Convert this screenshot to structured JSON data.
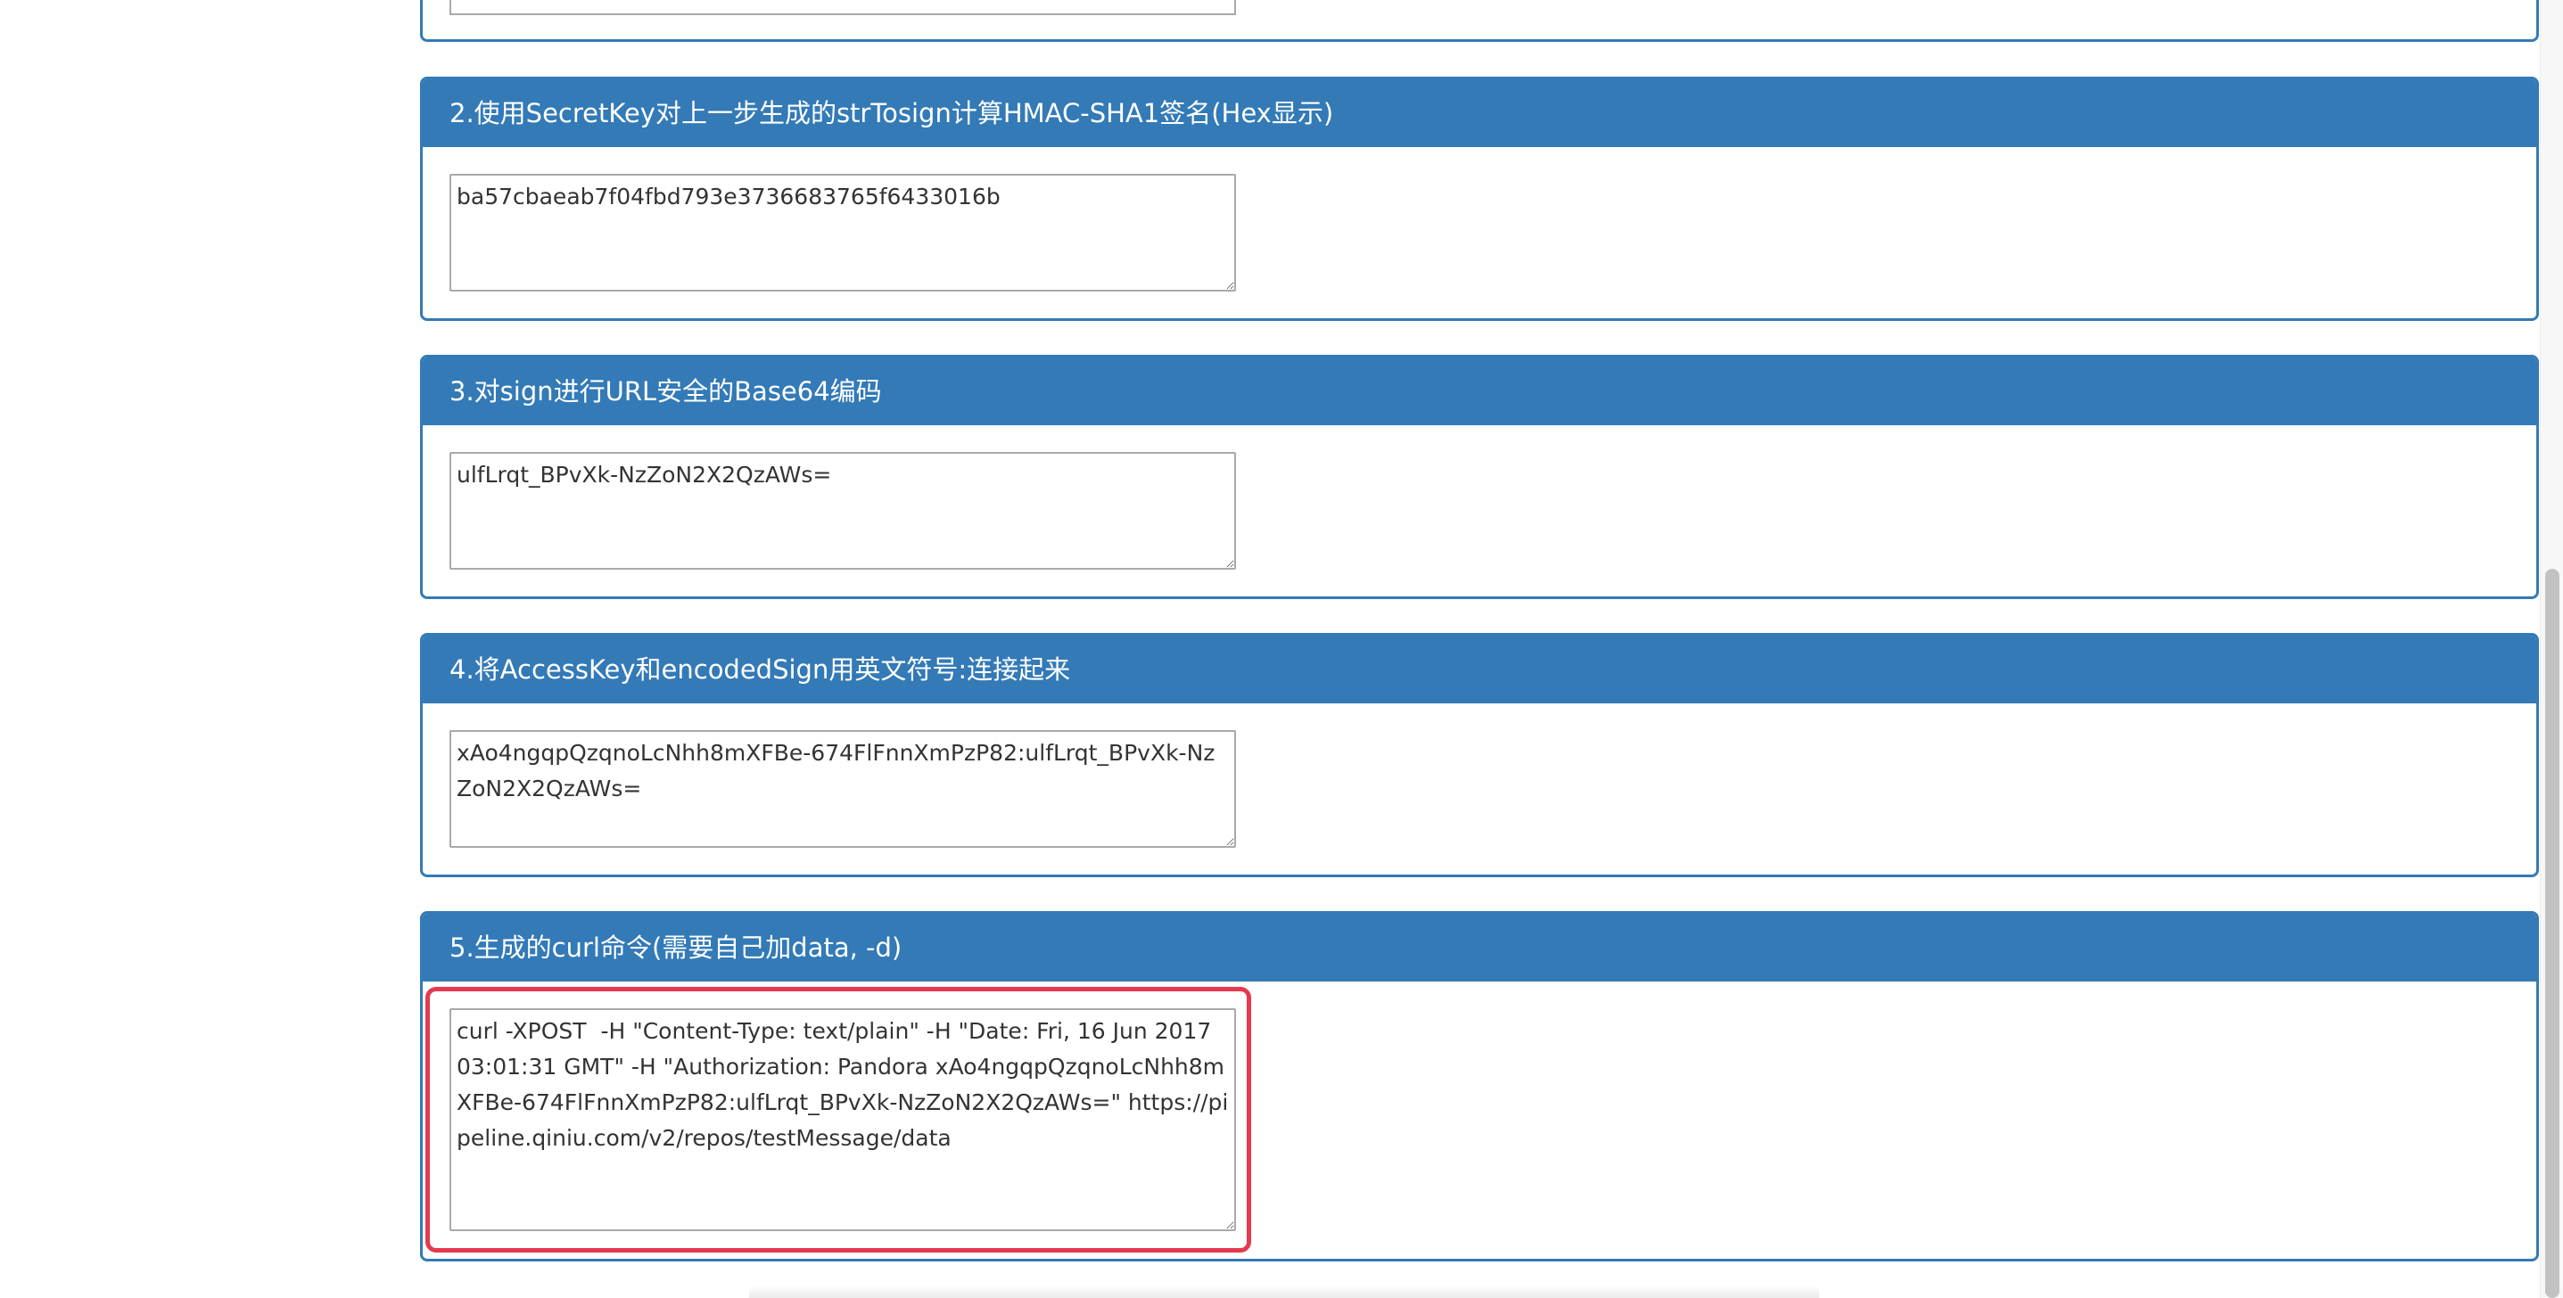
{
  "steps": [
    {
      "heading": "2.使用SecretKey对上一步生成的strTosign计算HMAC-SHA1签名(Hex显示)",
      "value": "ba57cbaeab7f04fbd793e3736683765f6433016b"
    },
    {
      "heading": "3.对sign进行URL安全的Base64编码",
      "value": "ulfLrqt_BPvXk-NzZoN2X2QzAWs="
    },
    {
      "heading": "4.将AccessKey和encodedSign用英文符号:连接起来",
      "value": "xAo4ngqpQzqnoLcNhh8mXFBe-674FlFnnXmPzP82:ulfLrqt_BPvXk-NzZoN2X2QzAWs="
    },
    {
      "heading": "5.生成的curl命令(需要自己加data, -d)",
      "value": "curl -XPOST  -H \"Content-Type: text/plain\" -H \"Date: Fri, 16 Jun 2017 03:01:31 GMT\" -H \"Authorization: Pandora xAo4ngqpQzqnoLcNhh8mXFBe-674FlFnnXmPzP82:ulfLrqt_BPvXk-NzZoN2X2QzAWs=\" https://pipeline.qiniu.com/v2/repos/testMessage/data"
    }
  ],
  "highlight_color": "#e53950",
  "accent_color": "#337ab7"
}
